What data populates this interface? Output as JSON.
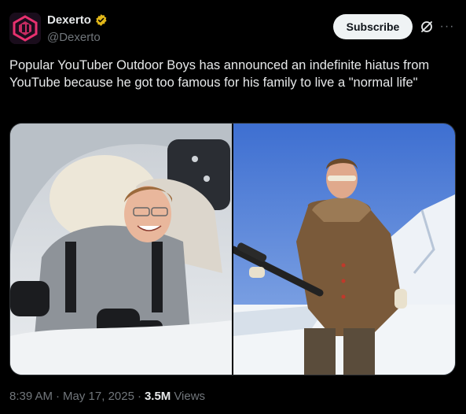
{
  "author": {
    "display_name": "Dexerto",
    "handle": "@Dexerto",
    "verified_color": "#e2b719",
    "avatar_bg": "#1a0d1c",
    "avatar_accent": "#e8316f"
  },
  "actions": {
    "subscribe_label": "Subscribe",
    "grok_icon": "grok-icon",
    "more_icon": "more-icon"
  },
  "tweet": {
    "text": "Popular YouTuber Outdoor Boys has announced an indefinite hiatus from YouTube because he got too famous for his family to live a \"normal life\""
  },
  "media": {
    "count": 2
  },
  "meta": {
    "time": "8:39 AM",
    "separator": "·",
    "date": "May 17, 2025",
    "views_count": "3.5M",
    "views_label": "Views"
  },
  "colors": {
    "background": "#000000",
    "text_primary": "#e7e9ea",
    "text_secondary": "#71767b",
    "button_bg": "#eff3f4",
    "button_text": "#0f1419"
  }
}
